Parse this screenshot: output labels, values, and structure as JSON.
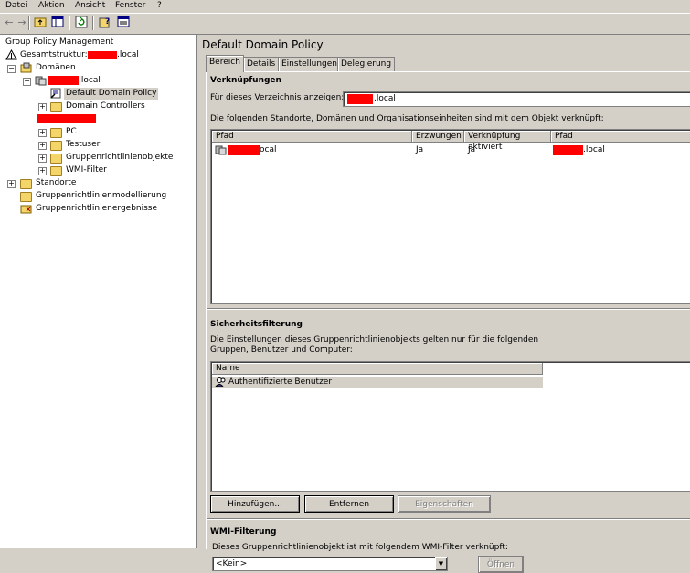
{
  "menu": {
    "items": [
      {
        "label": "Datei"
      },
      {
        "label": "Aktion"
      },
      {
        "label": "Ansicht"
      },
      {
        "label": "Fenster"
      },
      {
        "label": "?"
      }
    ]
  },
  "toolbar": {
    "icons": [
      "back-arrow-icon",
      "forward-arrow-icon",
      "up-folder-icon",
      "show-hide-tree-icon",
      "refresh-icon",
      "help-icon",
      "properties-icon"
    ]
  },
  "tree": {
    "root": "Group Policy Management",
    "forest": "Gesamtstruktur:",
    "forest_suffix": ".local",
    "domains": "Domänen",
    "domain_suffix": ".local",
    "default_domain_policy": "Default Domain Policy",
    "domain_controllers": "Domain Controllers",
    "pc": "PC",
    "testuser": "Testuser",
    "gpo": "Gruppenrichtlinienobjekte",
    "wmi": "WMI-Filter",
    "sites": "Standorte",
    "modeling": "Gruppenrichtlinienmodellierung",
    "results": "Gruppenrichtlinienergebnisse"
  },
  "detail": {
    "title": "Default Domain Policy",
    "tabs": [
      {
        "label": "Bereich"
      },
      {
        "label": "Details"
      },
      {
        "label": "Einstellungen"
      },
      {
        "label": "Delegierung"
      }
    ],
    "links": {
      "title": "Verknüpfungen",
      "show_for_label": "Für dieses Verzeichnis anzeigen:",
      "show_for_value_suffix": ".local",
      "description": "Die folgenden Standorte, Domänen und Organisationseinheiten sind mit dem Objekt verknüpft:",
      "columns": [
        "Pfad",
        "Erzwungen",
        "Verknüpfung aktiviert",
        "Pfad"
      ],
      "rows": [
        {
          "path_suffix": "ocal",
          "enforced": "Ja",
          "enabled": "Ja",
          "path2_suffix": ".local"
        }
      ]
    },
    "security": {
      "title": "Sicherheitsfilterung",
      "description_line1": "Die Einstellungen dieses Gruppenrichtlinienobjekts gelten nur für die folgenden",
      "description_line2": "Gruppen, Benutzer und Computer:",
      "column": "Name",
      "rows": [
        "Authentifizierte Benutzer"
      ],
      "add_button": "Hinzufügen...",
      "remove_button": "Entfernen",
      "properties_button": "Eigenschaften"
    },
    "wmi": {
      "title": "WMI-Filterung",
      "description": "Dieses Gruppenrichtlinienobjekt ist mit folgendem WMI-Filter verknüpft:",
      "selected": "<Kein>",
      "open_button": "Öffnen"
    }
  },
  "colors": {
    "redaction": "#ff0000",
    "selection": "#d4d0c8"
  }
}
